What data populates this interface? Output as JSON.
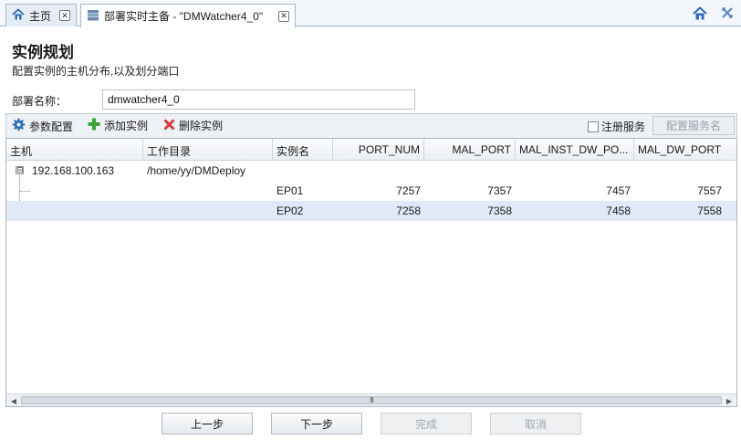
{
  "tabs": [
    {
      "label": "主页",
      "icon": "home-icon"
    },
    {
      "label": "部署实时主备 - \"DMWatcher4_0\"",
      "icon": "server-icon"
    }
  ],
  "header": {
    "title": "实例规划",
    "subtitle": "配置实例的主机分布,以及划分端口"
  },
  "form": {
    "name_label": "部署名称：",
    "name_value": "dmwatcher4_0"
  },
  "toolbar": {
    "params_label": "参数配置",
    "add_label": "添加实例",
    "delete_label": "删除实例",
    "register_service_label": "注册服务",
    "configure_service_label": "配置服务名"
  },
  "grid": {
    "columns": [
      "主机",
      "工作目录",
      "实例名",
      "PORT_NUM",
      "MAL_PORT",
      "MAL_INST_DW_PO...",
      "MAL_DW_PORT"
    ],
    "host": {
      "ip": "192.168.100.163",
      "dir": "/home/yy/DMDeploy",
      "expander": "⊟"
    },
    "instances": [
      {
        "name": "EP01",
        "port_num": "7257",
        "mal_port": "7357",
        "mal_inst_dw_port": "7457",
        "mal_dw_port": "7557"
      },
      {
        "name": "EP02",
        "port_num": "7258",
        "mal_port": "7358",
        "mal_inst_dw_port": "7458",
        "mal_dw_port": "7558"
      }
    ],
    "scroll_grip": "III"
  },
  "footer": {
    "prev": "上一步",
    "next": "下一步",
    "finish": "完成",
    "cancel": "取消"
  },
  "colors": {
    "selected_row": "#dfe9f7",
    "accent_blue": "#2d6db5",
    "add_green": "#3aa63a",
    "delete_red": "#d23c3c"
  }
}
